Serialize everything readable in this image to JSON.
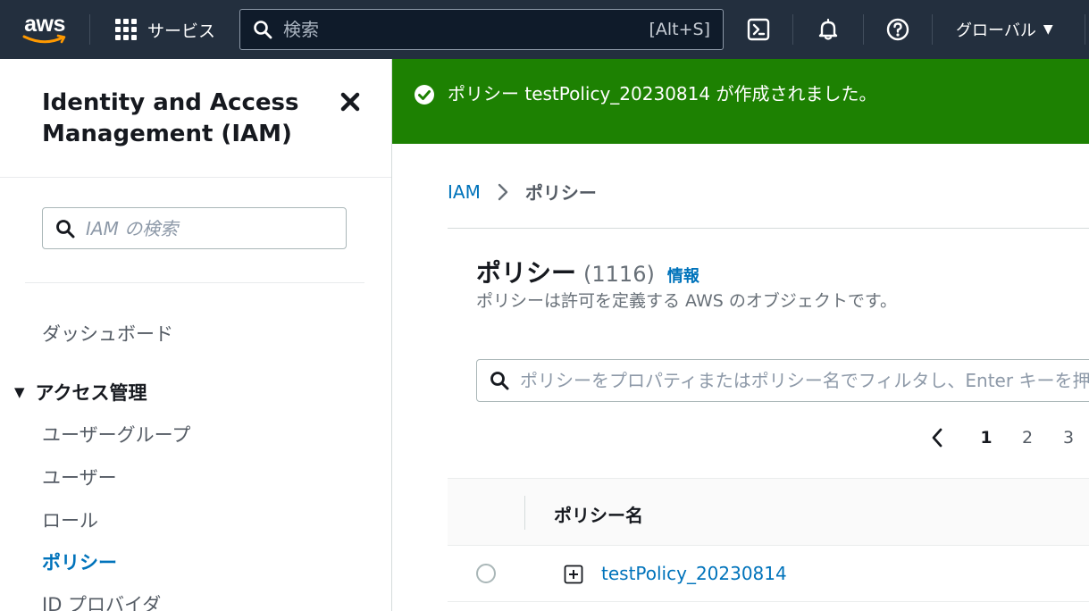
{
  "topnav": {
    "logo_text": "aws",
    "services_label": "サービス",
    "search_placeholder": "検索",
    "search_shortcut": "[Alt+S]",
    "region_label": "グローバル",
    "icons": [
      "grid-icon",
      "search-icon",
      "cloudshell-icon",
      "bell-icon",
      "help-icon",
      "caret-down-icon"
    ]
  },
  "sidebar": {
    "title": "Identity and Access Management (IAM)",
    "search_placeholder": "IAM の検索",
    "dashboard": "ダッシュボード",
    "section_access": "アクセス管理",
    "items": [
      {
        "label": "ユーザーグループ"
      },
      {
        "label": "ユーザー"
      },
      {
        "label": "ロール"
      },
      {
        "label": "ポリシー",
        "active": true
      },
      {
        "label": "ID プロバイダ"
      }
    ]
  },
  "flash": {
    "message": "ポリシー testPolicy_20230814 が作成されました。",
    "status_color": "#1d8102"
  },
  "breadcrumb": {
    "root": "IAM",
    "current": "ポリシー"
  },
  "policies": {
    "title": "ポリシー",
    "count": "(1116)",
    "info_link": "情報",
    "description": "ポリシーは許可を定義する AWS のオブジェクトです。",
    "filter_placeholder": "ポリシーをプロパティまたはポリシー名でフィルタし、Enter キーを押します",
    "pagination": {
      "pages": [
        "1",
        "2",
        "3"
      ],
      "current": "1"
    },
    "columns": [
      "ポリシー名"
    ],
    "rows": [
      {
        "name": "testPolicy_20230814"
      }
    ]
  },
  "colors": {
    "nav_bg": "#232f3e",
    "link": "#0073bb",
    "success": "#1d8102"
  }
}
